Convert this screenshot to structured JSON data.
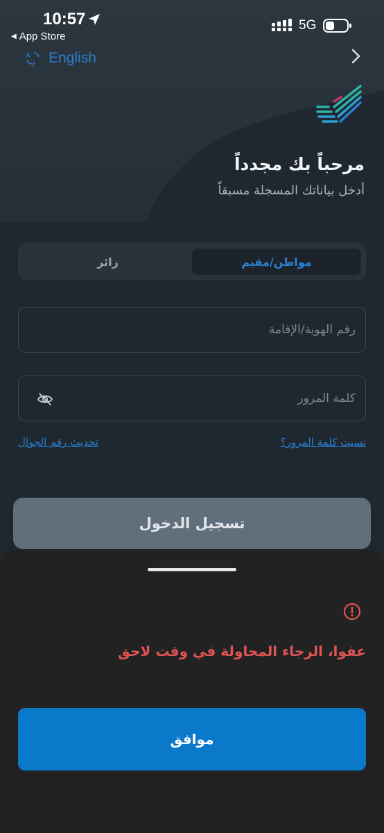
{
  "status_bar": {
    "time": "10:57",
    "back_app": "App Store",
    "network": "5G"
  },
  "header": {
    "language_label": "English",
    "language_icon": "translate-icon",
    "back_icon": "chevron-right-icon"
  },
  "welcome": {
    "title": "مرحباً بك مجدداً",
    "subtitle": "أدخل بياناتك المسجلة مسبقاً"
  },
  "user_type_tabs": {
    "active": "مواطن/مقيم",
    "inactive": "زائر"
  },
  "form": {
    "id_placeholder": "رقم الهوية/الإقامة",
    "password_placeholder": "كلمة المرور",
    "forgot_password": "نسيت كلمة المرور؟",
    "update_mobile": "تحديث رقم الجوال",
    "login_button": "تسجيل الدخول"
  },
  "error_sheet": {
    "message": "عفوا، الرجاء المحاولة في وقت لاحق",
    "ok_button": "موافق"
  },
  "colors": {
    "background": "#1f272f",
    "accent": "#2a7fd0",
    "error": "#e05454",
    "primary_button": "#0a79c9",
    "disabled_button": "#616f7d",
    "sheet": "#222222"
  }
}
